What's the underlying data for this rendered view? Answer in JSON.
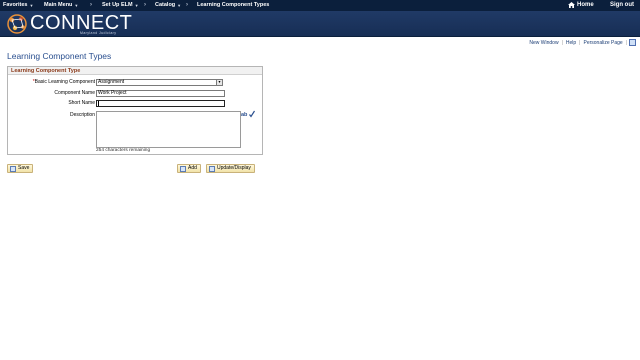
{
  "nav": {
    "favorites": "Favorites",
    "main_menu": "Main Menu",
    "sep": "›",
    "setup_elm": "Set Up ELM",
    "catalog": "Catalog",
    "current": "Learning Component Types",
    "home": "Home",
    "sign_out": "Sign out"
  },
  "banner": {
    "logo_text": "CONNECT",
    "logo_sub": "Maryland Judiciary"
  },
  "utils": {
    "new_window": "New Window",
    "help": "Help",
    "personalize": "Personalize Page",
    "sep": "|"
  },
  "page_title": "Learning Component Types",
  "group": {
    "title": "Learning Component Type",
    "required_mark": "*",
    "basic_label": "Basic Learning Component",
    "basic_value": "Assignment",
    "name_label": "Component Name",
    "name_value": "Work Project",
    "short_label": "Short Name",
    "short_value": "",
    "desc_label": "Description",
    "remaining": "254 characters remaining"
  },
  "buttons": {
    "save": "Save",
    "add": "Add",
    "update": "Update/Display"
  },
  "colors": {
    "nav_bg": "#0b1f3c",
    "title_blue": "#2a4f8f",
    "group_title": "#8b3a1a"
  }
}
